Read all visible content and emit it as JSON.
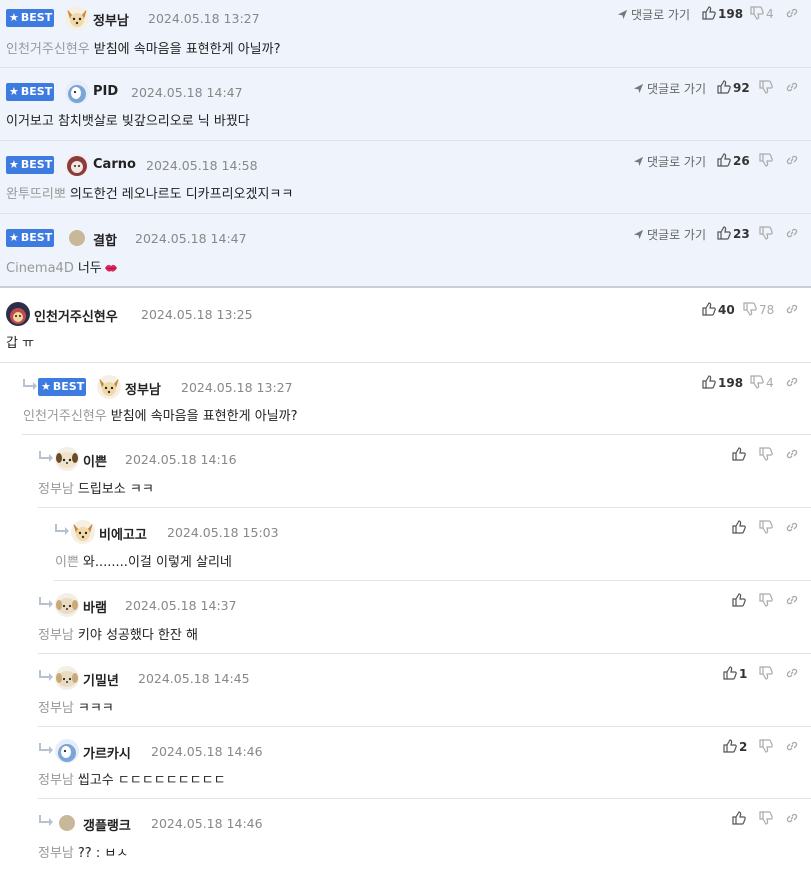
{
  "ui": {
    "best_label": "BEST",
    "goto_label": "댓글로 가기"
  },
  "comments": [
    {
      "nick": "정부남",
      "date": "2024.05.18 13:27",
      "mention": "인천거주신현우",
      "text": "받침에 속마음을 표현한게 아닐까?",
      "up": "198",
      "down": "4"
    },
    {
      "nick": "PID",
      "date": "2024.05.18 14:47",
      "mention": "",
      "text": "이거보고 참치뱃살로 빚갚으리오로 닉 바꿨다",
      "up": "92",
      "down": ""
    },
    {
      "nick": "Carno",
      "date": "2024.05.18 14:58",
      "mention": "완투뜨리뽀",
      "text": "의도한건 레오나르도 디카프리오겠지ㅋㅋ",
      "up": "26",
      "down": ""
    },
    {
      "nick": "결합",
      "date": "2024.05.18 14:47",
      "mention": "Cinema4D",
      "text": "너두",
      "up": "23",
      "down": ""
    },
    {
      "nick": "인천거주신현우",
      "date": "2024.05.18 13:25",
      "mention": "",
      "text": "갑 ㅠ",
      "up": "40",
      "down": "78"
    },
    {
      "nick": "정부남",
      "date": "2024.05.18 13:27",
      "mention": "인천거주신현우",
      "text": "받침에 속마음을 표현한게 아닐까?",
      "up": "198",
      "down": "4"
    },
    {
      "nick": "이쁜",
      "date": "2024.05.18 14:16",
      "mention": "정부남",
      "text": "드립보소 ㅋㅋ",
      "up": "",
      "down": ""
    },
    {
      "nick": "비에고고",
      "date": "2024.05.18 15:03",
      "mention": "이쁜",
      "text": "와........이걸 이렇게 살리네",
      "up": "",
      "down": ""
    },
    {
      "nick": "바램",
      "date": "2024.05.18 14:37",
      "mention": "정부남",
      "text": "키야 성공했다 한잔 해",
      "up": "",
      "down": ""
    },
    {
      "nick": "기밀년",
      "date": "2024.05.18 14:45",
      "mention": "정부남",
      "text": "ㅋㅋㅋ",
      "up": "1",
      "down": ""
    },
    {
      "nick": "가르카시",
      "date": "2024.05.18 14:46",
      "mention": "정부남",
      "text": "씹고수 ㄷㄷㄷㄷㄷㄷㄷㄷㄷ",
      "up": "2",
      "down": ""
    },
    {
      "nick": "갱플랭크",
      "date": "2024.05.18 14:46",
      "mention": "정부남",
      "text": "?? : ㅂㅅ",
      "up": "",
      "down": ""
    }
  ]
}
